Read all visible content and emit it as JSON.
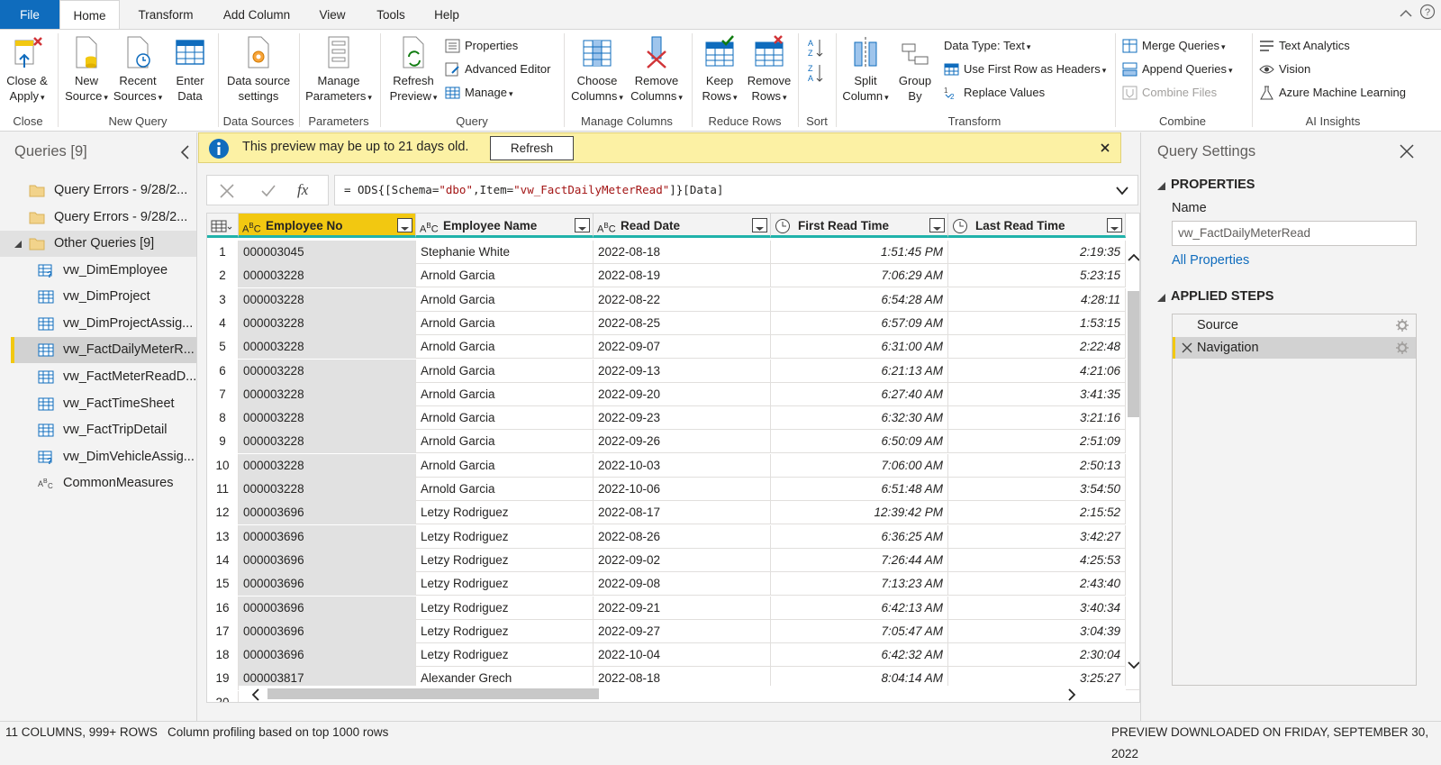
{
  "menu": {
    "tabs": [
      "File",
      "Home",
      "Transform",
      "Add Column",
      "View",
      "Tools",
      "Help"
    ]
  },
  "ribbon": {
    "close_apply": "Close &",
    "close_apply_2": "Apply",
    "new_source": "New",
    "new_source_2": "Source",
    "recent_sources": "Recent",
    "recent_sources_2": "Sources",
    "enter_data": "Enter",
    "enter_data_2": "Data",
    "data_source_settings": "Data source",
    "data_source_settings_2": "settings",
    "manage_parameters": "Manage",
    "manage_parameters_2": "Parameters",
    "refresh_preview": "Refresh",
    "refresh_preview_2": "Preview",
    "properties": "Properties",
    "advanced_editor": "Advanced Editor",
    "manage": "Manage",
    "choose_columns": "Choose",
    "choose_columns_2": "Columns",
    "remove_columns": "Remove",
    "remove_columns_2": "Columns",
    "keep_rows": "Keep",
    "keep_rows_2": "Rows",
    "remove_rows": "Remove",
    "remove_rows_2": "Rows",
    "split_column": "Split",
    "split_column_2": "Column",
    "group_by": "Group",
    "group_by_2": "By",
    "data_type": "Data Type: Text",
    "use_first_row": "Use First Row as Headers",
    "replace_values": "Replace Values",
    "merge_queries": "Merge Queries",
    "append_queries": "Append Queries",
    "combine_files": "Combine Files",
    "text_analytics": "Text Analytics",
    "vision": "Vision",
    "azure_ml": "Azure Machine Learning",
    "groups": {
      "close": "Close",
      "new_query": "New Query",
      "data_sources": "Data Sources",
      "parameters": "Parameters",
      "query": "Query",
      "manage_columns": "Manage Columns",
      "reduce_rows": "Reduce Rows",
      "sort": "Sort",
      "transform": "Transform",
      "combine": "Combine",
      "ai_insights": "AI Insights"
    }
  },
  "queries": {
    "title": "Queries [9]",
    "items": [
      {
        "label": "Query Errors - 9/28/2...",
        "icon": "folder-icon"
      },
      {
        "label": "Query Errors - 9/28/2...",
        "icon": "folder-icon"
      },
      {
        "label": "Other Queries [9]",
        "icon": "folder-icon"
      },
      {
        "label": "vw_DimEmployee",
        "icon": "table-warning-icon"
      },
      {
        "label": "vw_DimProject",
        "icon": "table-icon"
      },
      {
        "label": "vw_DimProjectAssig...",
        "icon": "table-icon"
      },
      {
        "label": "vw_FactDailyMeterR...",
        "icon": "table-icon"
      },
      {
        "label": "vw_FactMeterReadD...",
        "icon": "table-icon"
      },
      {
        "label": "vw_FactTimeSheet",
        "icon": "table-icon"
      },
      {
        "label": "vw_FactTripDetail",
        "icon": "table-icon"
      },
      {
        "label": "vw_DimVehicleAssig...",
        "icon": "table-warning-icon"
      },
      {
        "label": "CommonMeasures",
        "icon": "abc-icon"
      }
    ]
  },
  "infobar": {
    "message": "This preview may be up to 21 days old.",
    "refresh": "Refresh"
  },
  "formula": {
    "prefix": "= ODS{[Schema=",
    "schema": "\"dbo\"",
    "mid": ",Item=",
    "item": "\"vw_FactDailyMeterRead\"",
    "suffix": "]}[Data]",
    "fx": "fx"
  },
  "grid": {
    "columns": [
      "Employee No",
      "Employee Name",
      "Read Date",
      "First Read Time",
      "Last Read Time"
    ],
    "rows": [
      [
        "1",
        "000003045",
        "Stephanie White",
        "2022-08-18",
        "1:51:45 PM",
        "2:19:35"
      ],
      [
        "2",
        "000003228",
        "Arnold Garcia",
        "2022-08-19",
        "7:06:29 AM",
        "5:23:15"
      ],
      [
        "3",
        "000003228",
        "Arnold Garcia",
        "2022-08-22",
        "6:54:28 AM",
        "4:28:11"
      ],
      [
        "4",
        "000003228",
        "Arnold Garcia",
        "2022-08-25",
        "6:57:09 AM",
        "1:53:15"
      ],
      [
        "5",
        "000003228",
        "Arnold Garcia",
        "2022-09-07",
        "6:31:00 AM",
        "2:22:48"
      ],
      [
        "6",
        "000003228",
        "Arnold Garcia",
        "2022-09-13",
        "6:21:13 AM",
        "4:21:06"
      ],
      [
        "7",
        "000003228",
        "Arnold Garcia",
        "2022-09-20",
        "6:27:40 AM",
        "3:41:35"
      ],
      [
        "8",
        "000003228",
        "Arnold Garcia",
        "2022-09-23",
        "6:32:30 AM",
        "3:21:16"
      ],
      [
        "9",
        "000003228",
        "Arnold Garcia",
        "2022-09-26",
        "6:50:09 AM",
        "2:51:09"
      ],
      [
        "10",
        "000003228",
        "Arnold Garcia",
        "2022-10-03",
        "7:06:00 AM",
        "2:50:13"
      ],
      [
        "11",
        "000003228",
        "Arnold Garcia",
        "2022-10-06",
        "6:51:48 AM",
        "3:54:50"
      ],
      [
        "12",
        "000003696",
        "Letzy Rodriguez",
        "2022-08-17",
        "12:39:42 PM",
        "2:15:52"
      ],
      [
        "13",
        "000003696",
        "Letzy Rodriguez",
        "2022-08-26",
        "6:36:25 AM",
        "3:42:27"
      ],
      [
        "14",
        "000003696",
        "Letzy Rodriguez",
        "2022-09-02",
        "7:26:44 AM",
        "4:25:53"
      ],
      [
        "15",
        "000003696",
        "Letzy Rodriguez",
        "2022-09-08",
        "7:13:23 AM",
        "2:43:40"
      ],
      [
        "16",
        "000003696",
        "Letzy Rodriguez",
        "2022-09-21",
        "6:42:13 AM",
        "3:40:34"
      ],
      [
        "17",
        "000003696",
        "Letzy Rodriguez",
        "2022-09-27",
        "7:05:47 AM",
        "3:04:39"
      ],
      [
        "18",
        "000003696",
        "Letzy Rodriguez",
        "2022-10-04",
        "6:42:32 AM",
        "2:30:04"
      ],
      [
        "19",
        "000003817",
        "Alexander Grech",
        "2022-08-18",
        "8:04:14 AM",
        "3:25:27"
      ],
      [
        "20",
        "",
        "",
        "",
        "",
        ""
      ]
    ]
  },
  "settings": {
    "title": "Query Settings",
    "properties": "PROPERTIES",
    "name_label": "Name",
    "name_value": "vw_FactDailyMeterRead",
    "all_properties": "All Properties",
    "applied_steps": "APPLIED STEPS",
    "steps": [
      "Source",
      "Navigation"
    ]
  },
  "status": {
    "columns_rows": "11 COLUMNS, 999+ ROWS",
    "profiling": "Column profiling based on top 1000 rows",
    "preview": "PREVIEW DOWNLOADED ON FRIDAY, SEPTEMBER 30, 2022"
  },
  "colors": {
    "accent": "#0f6cbd",
    "selected_header": "#f2c811",
    "info_bar": "#fcf1a4",
    "header_underline": "#20b2aa"
  }
}
